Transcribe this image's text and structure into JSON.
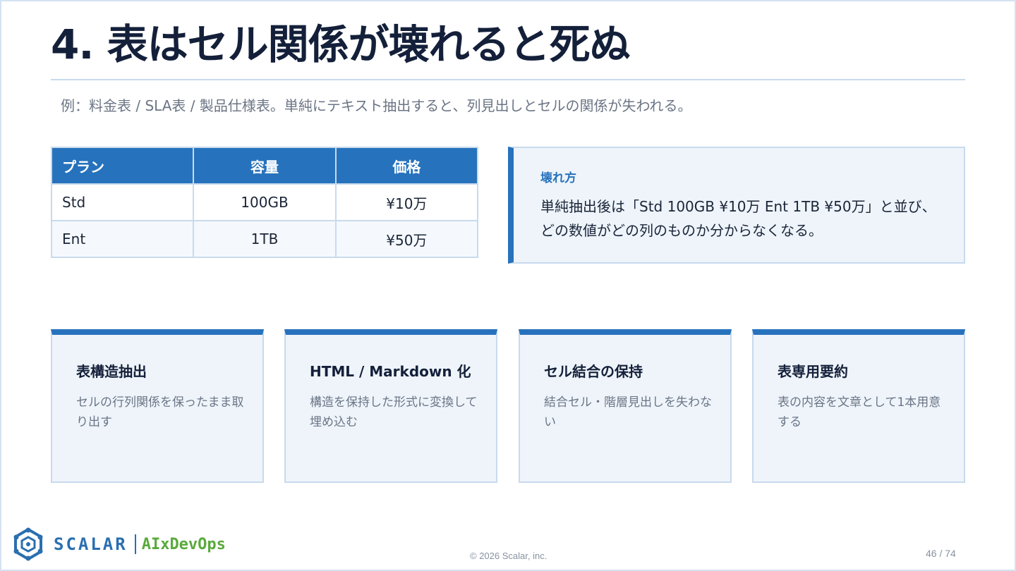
{
  "slide": {
    "title": "4. 表はセル関係が壊れると死ぬ",
    "subtitle": "例：料金表 / SLA表 / 製品仕様表。単純にテキスト抽出すると、列見出しとセルの関係が失われる。"
  },
  "table": {
    "headers": [
      "プラン",
      "容量",
      "価格"
    ],
    "rows": [
      [
        "Std",
        "100GB",
        "¥10万"
      ],
      [
        "Ent",
        "1TB",
        "¥50万"
      ]
    ]
  },
  "callout": {
    "heading": "壊れ方",
    "body": "単純抽出後は「Std 100GB ¥10万 Ent 1TB ¥50万」と並び、どの数値がどの列のものか分からなくなる。"
  },
  "cards": [
    {
      "title": "表構造抽出",
      "desc": "セルの行列関係を保ったまま取り出す"
    },
    {
      "title": "HTML / Markdown 化",
      "desc": "構造を保持した形式に変換して埋め込む"
    },
    {
      "title": "セル結合の保持",
      "desc": "結合セル・階層見出しを失わない"
    },
    {
      "title": "表専用要約",
      "desc": "表の内容を文章として1本用意する"
    }
  ],
  "footer": {
    "logo_icon": "scalar-logo-icon",
    "brand": "SCALAR",
    "product": "AIxDevOps",
    "copyright": "© 2026 Scalar, inc.",
    "page": "46 / 74"
  },
  "colors": {
    "accent": "#2772bc",
    "title": "#14203a",
    "muted": "#6b7585",
    "panel_bg": "#eef4fa",
    "border": "#c8daee",
    "brand_blue": "#2a6fb0",
    "brand_green": "#5aaa3c"
  }
}
